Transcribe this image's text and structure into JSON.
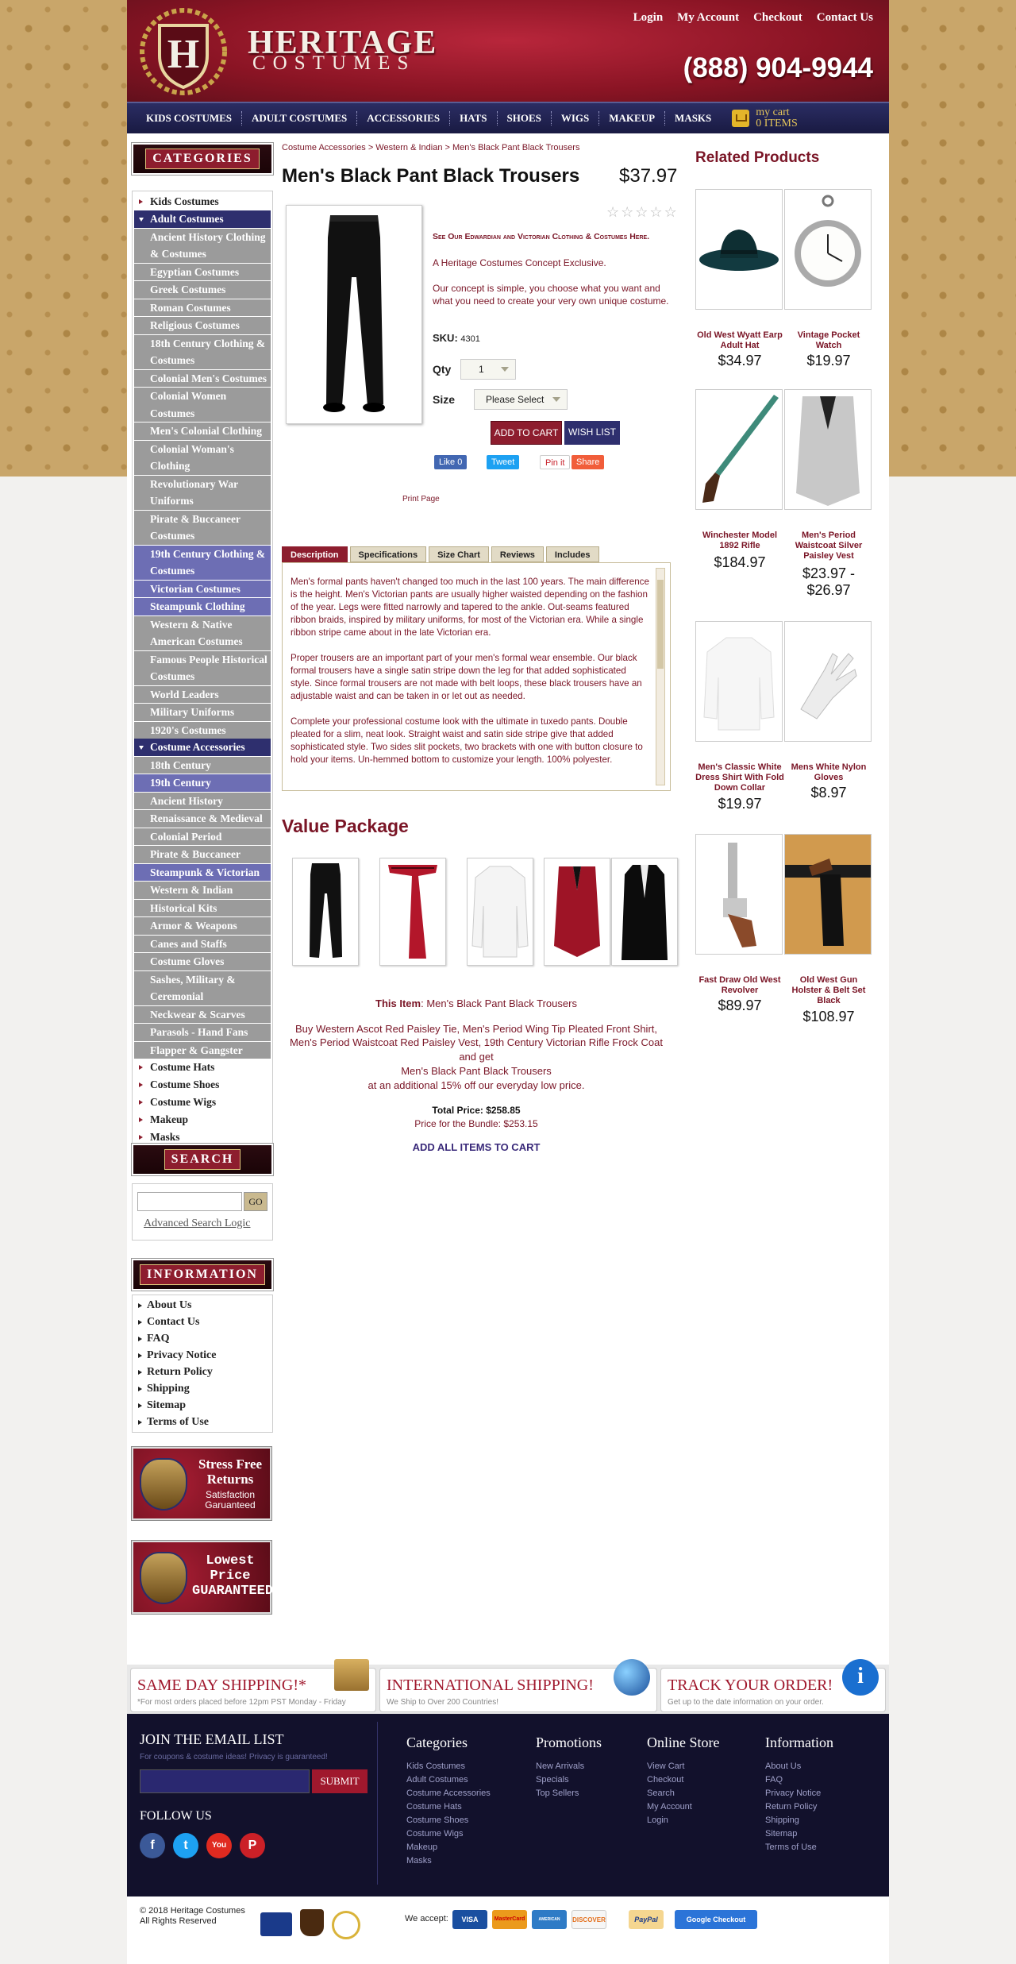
{
  "header": {
    "logo_title": "HERITAGE",
    "logo_subtitle": "COSTUMES",
    "logo_letter": "H",
    "phone": "(888) 904-9944",
    "links": [
      "Login",
      "My Account",
      "Checkout",
      "Contact Us"
    ]
  },
  "nav": {
    "items": [
      "KIDS COSTUMES",
      "ADULT COSTUMES",
      "ACCESSORIES",
      "HATS",
      "SHOES",
      "WIGS",
      "MAKEUP",
      "MASKS"
    ],
    "cart_label": "my cart",
    "cart_count": "0 ITEMS"
  },
  "sidebar": {
    "categories_title": "CATEGORIES",
    "kids": "Kids Costumes",
    "adult": "Adult Costumes",
    "adult_sub": [
      "Ancient History Clothing & Costumes",
      "Egyptian Costumes",
      "Greek Costumes",
      "Roman Costumes",
      "Religious Costumes",
      "18th Century Clothing & Costumes",
      "Colonial Men's Costumes",
      "Colonial Women Costumes",
      "Men's Colonial Clothing",
      "Colonial Woman's Clothing",
      "Revolutionary War Uniforms",
      "Pirate & Buccaneer Costumes",
      "19th Century Clothing & Costumes",
      "Victorian Costumes",
      "Steampunk Clothing",
      "Western & Native American Costumes",
      "Famous People Historical Costumes",
      "World Leaders",
      "Military Uniforms",
      "1920's Costumes"
    ],
    "accessories": "Costume Accessories",
    "acc_sub": [
      "18th Century",
      "19th Century",
      "Ancient History",
      "Renaissance & Medieval",
      "Colonial Period",
      "Pirate & Buccaneer",
      "Steampunk & Victorian",
      "Western & Indian",
      "Historical Kits",
      "Armor & Weapons",
      "Canes and Staffs",
      "Costume Gloves",
      "Sashes, Military & Ceremonial",
      "Neckwear & Scarves",
      "Parasols - Hand Fans",
      "Flapper & Gangster"
    ],
    "bottom_cats": [
      "Costume Hats",
      "Costume Shoes",
      "Costume Wigs",
      "Makeup",
      "Masks"
    ],
    "search_title": "SEARCH",
    "go": "GO",
    "advanced": "Advanced Search Logic",
    "information_title": "INFORMATION",
    "info_links": [
      "About Us",
      "Contact Us",
      "FAQ",
      "Privacy Notice",
      "Return Policy",
      "Shipping",
      "Sitemap",
      "Terms of Use"
    ],
    "promo1_title": "Stress Free Returns",
    "promo1_sub": "Satisfaction Garuanteed",
    "promo2_title": "Lowest Price GUARANTEED"
  },
  "product": {
    "breadcrumb": "Costume Accessories > Western & Indian > Men's Black Pant Black Trousers",
    "title": "Men's Black Pant Black Trousers",
    "price": "$37.97",
    "edwardian_link": "See Our Edwardian and Victorian Clothing & Costumes Here.",
    "exclusive": "A Heritage Costumes Concept Exclusive.",
    "concept": "Our concept is simple, you choose what you want and what you need to create your very own unique costume.",
    "sku_label": "SKU:",
    "sku": "4301",
    "qty_label": "Qty",
    "qty": "1",
    "size_label": "Size",
    "size_placeholder": "Please Select",
    "add_to_cart": "ADD TO CART",
    "wish_list": "WISH LIST",
    "like": "Like 0",
    "tweet": "Tweet",
    "pin": "Pin it",
    "share": "Share",
    "print": "Print Page",
    "tabs": [
      "Description",
      "Specifications",
      "Size Chart",
      "Reviews",
      "Includes"
    ],
    "description": [
      "Men's formal pants haven't changed too much in the last 100 years. The main difference is the height. Men's Victorian pants are usually higher waisted depending on the fashion of the year. Legs were fitted narrowly and tapered to the ankle. Out-seams featured ribbon braids, inspired by military uniforms, for most of the Victorian era. While a single ribbon stripe came about in the late Victorian era.",
      "Proper trousers are an important part of your men's formal wear ensemble.  Our black formal trousers have a single satin stripe down the leg for that added sophisticated style.  Since formal trousers are not made with belt loops, these black trousers have an adjustable waist and can be taken in or let out as needed.",
      "Complete your professional costume look with the ultimate in tuxedo pants. Double pleated for a slim, neat look. Straight waist and satin side stripe give that added sophisticated style. Two sides slit pockets, two brackets with one with button closure to hold your items. Un-hemmed bottom to customize your length. 100% polyester."
    ]
  },
  "value_package": {
    "title": "Value Package",
    "this_item_label": "This Item",
    "this_item": ": Men's Black Pant Black Trousers",
    "buy_line": "Buy Western Ascot Red Paisley Tie, Men's Period Wing Tip Pleated Front Shirt, Men's Period Waistcoat Red Paisley Vest, 19th Century Victorian Rifle Frock Coat",
    "and_get": "and get",
    "get_item": "Men's Black Pant Black Trousers",
    "discount": "at an additional 15% off our everyday low price.",
    "total": "Total Price: $258.85",
    "bundle": "Price for the Bundle: $253.15",
    "add_all": "ADD ALL ITEMS TO CART"
  },
  "related": {
    "title": "Related Products",
    "items": [
      {
        "name": "Old West Wyatt Earp Adult Hat",
        "price": "$34.97"
      },
      {
        "name": "Vintage Pocket Watch",
        "price": "$19.97"
      },
      {
        "name": "Winchester Model 1892 Rifle",
        "price": "$184.97"
      },
      {
        "name": "Men's Period Waistcoat Silver Paisley Vest",
        "price": "$23.97 - $26.97"
      },
      {
        "name": "Men's Classic White Dress Shirt With Fold Down Collar",
        "price": "$19.97"
      },
      {
        "name": "Mens White Nylon Gloves",
        "price": "$8.97"
      },
      {
        "name": "Fast Draw Old West Revolver",
        "price": "$89.97"
      },
      {
        "name": "Old West Gun Holster & Belt Set Black",
        "price": "$108.97"
      }
    ]
  },
  "shipping": [
    {
      "title": "SAME DAY SHIPPING!*",
      "sub": "*For most orders placed before 12pm PST Monday - Friday"
    },
    {
      "title": "INTERNATIONAL SHIPPING!",
      "sub": "We Ship to Over 200 Countries!"
    },
    {
      "title": "TRACK YOUR ORDER!",
      "sub": "Get up to the date information on your order."
    }
  ],
  "footer": {
    "email_title": "JOIN THE EMAIL LIST",
    "email_sub": "For coupons & costume ideas! Privacy is guaranteed!",
    "submit": "SUBMIT",
    "follow": "FOLLOW US",
    "columns": [
      {
        "title": "Categories",
        "links": [
          "Kids Costumes",
          "Adult Costumes",
          "Costume Accessories",
          "Costume Hats",
          "Costume Shoes",
          "Costume Wigs",
          "Makeup",
          "Masks"
        ]
      },
      {
        "title": "Promotions",
        "links": [
          "New Arrivals",
          "Specials",
          "Top Sellers"
        ]
      },
      {
        "title": "Online Store",
        "links": [
          "View Cart",
          "Checkout",
          "Search",
          "My Account",
          "Login"
        ]
      },
      {
        "title": "Information",
        "links": [
          "About Us",
          "FAQ",
          "Privacy Notice",
          "Return Policy",
          "Shipping",
          "Sitemap",
          "Terms of Use"
        ]
      }
    ],
    "copyright": "© 2018 Heritage Costumes",
    "rights": "All Rights Reserved",
    "we_accept": "We accept:",
    "payments": [
      "VISA",
      "MasterCard",
      "AMERICAN EXPRESS",
      "DISCOVER",
      "PayPal",
      "Google Checkout"
    ]
  }
}
